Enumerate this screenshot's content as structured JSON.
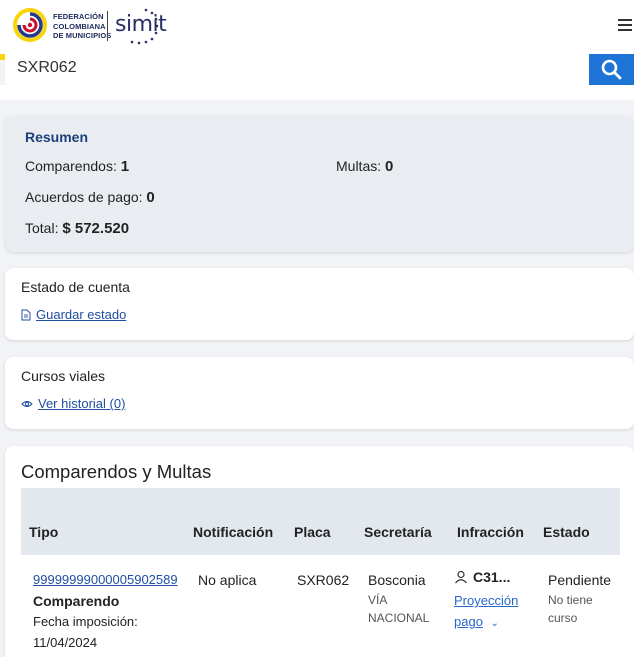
{
  "header": {
    "org_name_lines": [
      "FEDERACIÓN",
      "COLOMBIANA",
      "DE MUNICIPIOS"
    ],
    "product_logo": "simit",
    "menu_icon": "hamburger-menu-icon"
  },
  "search": {
    "value": "SXR062",
    "button_icon": "search-icon"
  },
  "resumen": {
    "title": "Resumen",
    "comparendos_label": "Comparendos:",
    "comparendos_value": "1",
    "multas_label": "Multas:",
    "multas_value": "0",
    "acuerdos_label": "Acuerdos de pago:",
    "acuerdos_value": "0",
    "total_label": "Total:",
    "total_value": "$ 572.520"
  },
  "estado_cuenta": {
    "title": "Estado de cuenta",
    "link_label": "Guardar estado",
    "link_icon": "document-icon"
  },
  "cursos_viales": {
    "title": "Cursos viales",
    "link_label": "Ver historial (0)",
    "link_icon": "eye-icon"
  },
  "comparendos_multas": {
    "title": "Comparendos y Multas",
    "columns": [
      "Tipo",
      "Notificación",
      "Placa",
      "Secretaría",
      "Infracción",
      "Estado"
    ],
    "rows": [
      {
        "numero": "99999999000005902589",
        "tipo": "Comparendo",
        "fecha_label": "Fecha imposición:",
        "fecha": "11/04/2024",
        "notificacion": "No aplica",
        "placa": "SXR062",
        "secretaria": "Bosconia",
        "secretaria_sub_1": "VÍA",
        "secretaria_sub_2": "NACIONAL",
        "infraccion_code": "C31...",
        "infraccion_link_1": "Proyección",
        "infraccion_link_2": "pago",
        "estado": "Pendiente",
        "estado_sub_1": "No tiene",
        "estado_sub_2": "curso"
      }
    ]
  },
  "colors": {
    "flag_yellow": "#f7d508",
    "flag_blue": "#24398c",
    "flag_red": "#c8102e",
    "search_button": "#1e73d6",
    "link": "#1f4fa3",
    "title_blue": "#1d3f7a"
  }
}
